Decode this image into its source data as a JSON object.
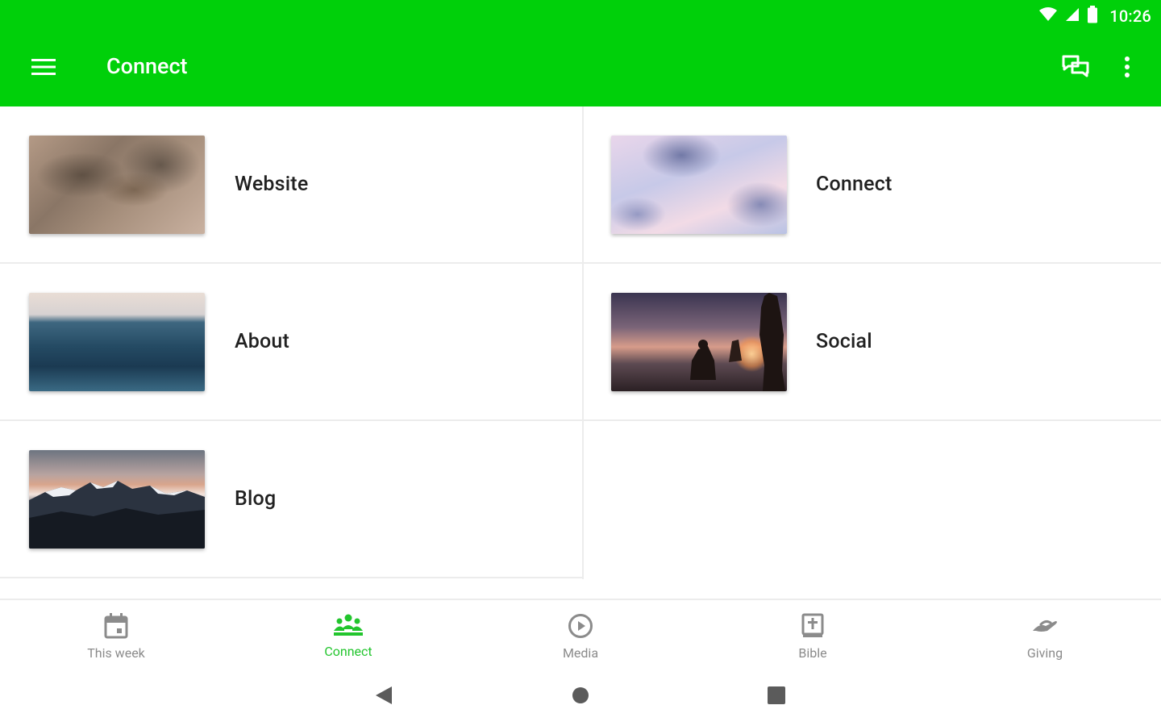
{
  "status": {
    "time": "10:26"
  },
  "toolbar": {
    "title": "Connect"
  },
  "items": [
    {
      "label": "Website",
      "image": "landscape-aerial"
    },
    {
      "label": "Connect",
      "image": "clouds-sky"
    },
    {
      "label": "About",
      "image": "ocean-waves"
    },
    {
      "label": "Social",
      "image": "sunset-people"
    },
    {
      "label": "Blog",
      "image": "mountains"
    }
  ],
  "bottom_nav": [
    {
      "label": "This week",
      "icon": "calendar-icon",
      "active": false
    },
    {
      "label": "Connect",
      "icon": "people-icon",
      "active": true
    },
    {
      "label": "Media",
      "icon": "play-circle-icon",
      "active": false
    },
    {
      "label": "Bible",
      "icon": "bible-icon",
      "active": false
    },
    {
      "label": "Giving",
      "icon": "giving-hand-icon",
      "active": false
    }
  ],
  "colors": {
    "primary": "#00d00a",
    "active_nav": "#22c52d",
    "inactive_nav": "#8b8b8b"
  }
}
